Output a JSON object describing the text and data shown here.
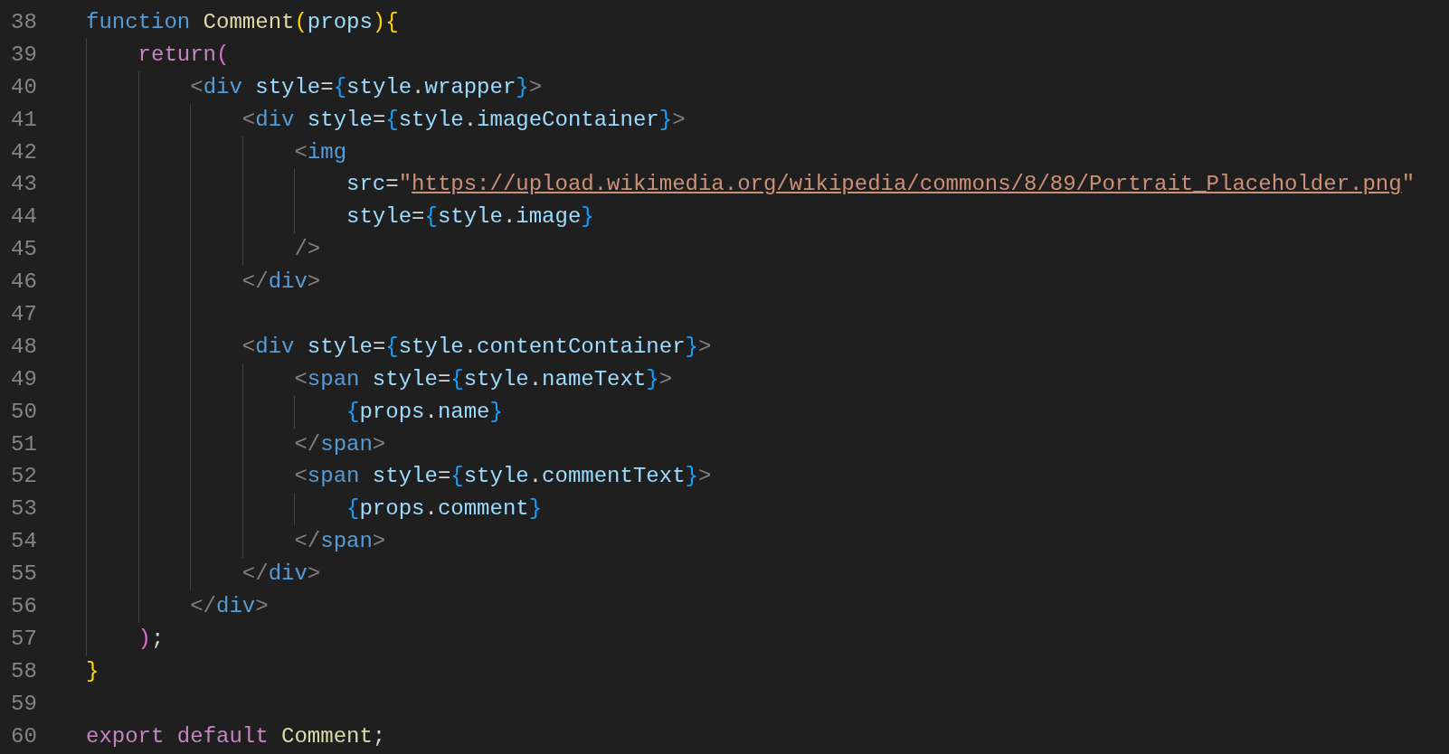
{
  "editor": {
    "lines": [
      {
        "number": "38",
        "tokens": [
          {
            "text": "function",
            "kind": "keyword"
          },
          {
            "text": " Comment",
            "kind": "function"
          },
          {
            "text": "(",
            "kind": "bracket1"
          },
          {
            "text": "props",
            "kind": "variable"
          },
          {
            "text": ")",
            "kind": "bracket1"
          },
          {
            "text": "{",
            "kind": "bracket1"
          }
        ]
      },
      {
        "number": "39",
        "tokens": [
          {
            "text": "    return",
            "kind": "control"
          },
          {
            "text": "(",
            "kind": "bracket2"
          }
        ]
      },
      {
        "number": "40",
        "tokens": [
          {
            "text": "        <",
            "kind": "tagpunct"
          },
          {
            "text": "div",
            "kind": "tag"
          },
          {
            "text": " style",
            "kind": "variable"
          },
          {
            "text": "=",
            "kind": "punct"
          },
          {
            "text": "{",
            "kind": "bracket3"
          },
          {
            "text": "style",
            "kind": "variable"
          },
          {
            "text": ".",
            "kind": "punct"
          },
          {
            "text": "wrapper",
            "kind": "variable"
          },
          {
            "text": "}",
            "kind": "bracket3"
          },
          {
            "text": ">",
            "kind": "tagpunct"
          }
        ]
      },
      {
        "number": "41",
        "tokens": [
          {
            "text": "            <",
            "kind": "tagpunct"
          },
          {
            "text": "div",
            "kind": "tag"
          },
          {
            "text": " style",
            "kind": "variable"
          },
          {
            "text": "=",
            "kind": "punct"
          },
          {
            "text": "{",
            "kind": "bracket3"
          },
          {
            "text": "style",
            "kind": "variable"
          },
          {
            "text": ".",
            "kind": "punct"
          },
          {
            "text": "imageContainer",
            "kind": "variable"
          },
          {
            "text": "}",
            "kind": "bracket3"
          },
          {
            "text": ">",
            "kind": "tagpunct"
          }
        ]
      },
      {
        "number": "42",
        "tokens": [
          {
            "text": "                <",
            "kind": "tagpunct"
          },
          {
            "text": "img",
            "kind": "tag"
          }
        ]
      },
      {
        "number": "43",
        "tokens": [
          {
            "text": "                    src",
            "kind": "variable"
          },
          {
            "text": "=",
            "kind": "punct"
          },
          {
            "text": "\"",
            "kind": "string"
          },
          {
            "text": "https://upload.wikimedia.org/wikipedia/commons/8/89/Portrait_Placeholder.png",
            "kind": "link"
          },
          {
            "text": "\"",
            "kind": "string"
          }
        ]
      },
      {
        "number": "44",
        "tokens": [
          {
            "text": "                    style",
            "kind": "variable"
          },
          {
            "text": "=",
            "kind": "punct"
          },
          {
            "text": "{",
            "kind": "bracket3"
          },
          {
            "text": "style",
            "kind": "variable"
          },
          {
            "text": ".",
            "kind": "punct"
          },
          {
            "text": "image",
            "kind": "variable"
          },
          {
            "text": "}",
            "kind": "bracket3"
          }
        ]
      },
      {
        "number": "45",
        "tokens": [
          {
            "text": "                />",
            "kind": "tagpunct"
          }
        ]
      },
      {
        "number": "46",
        "tokens": [
          {
            "text": "            </",
            "kind": "tagpunct"
          },
          {
            "text": "div",
            "kind": "tag"
          },
          {
            "text": ">",
            "kind": "tagpunct"
          }
        ]
      },
      {
        "number": "47"
      },
      {
        "number": "48",
        "tokens": [
          {
            "text": "            <",
            "kind": "tagpunct"
          },
          {
            "text": "div",
            "kind": "tag"
          },
          {
            "text": " style",
            "kind": "variable"
          },
          {
            "text": "=",
            "kind": "punct"
          },
          {
            "text": "{",
            "kind": "bracket3"
          },
          {
            "text": "style",
            "kind": "variable"
          },
          {
            "text": ".",
            "kind": "punct"
          },
          {
            "text": "contentContainer",
            "kind": "variable"
          },
          {
            "text": "}",
            "kind": "bracket3"
          },
          {
            "text": ">",
            "kind": "tagpunct"
          }
        ]
      },
      {
        "number": "49",
        "tokens": [
          {
            "text": "                <",
            "kind": "tagpunct"
          },
          {
            "text": "span",
            "kind": "tag"
          },
          {
            "text": " style",
            "kind": "variable"
          },
          {
            "text": "=",
            "kind": "punct"
          },
          {
            "text": "{",
            "kind": "bracket3"
          },
          {
            "text": "style",
            "kind": "variable"
          },
          {
            "text": ".",
            "kind": "punct"
          },
          {
            "text": "nameText",
            "kind": "variable"
          },
          {
            "text": "}",
            "kind": "bracket3"
          },
          {
            "text": ">",
            "kind": "tagpunct"
          }
        ]
      },
      {
        "number": "50",
        "tokens": [
          {
            "text": "                    {",
            "kind": "bracket3"
          },
          {
            "text": "props",
            "kind": "variable"
          },
          {
            "text": ".",
            "kind": "punct"
          },
          {
            "text": "name",
            "kind": "variable"
          },
          {
            "text": "}",
            "kind": "bracket3"
          }
        ]
      },
      {
        "number": "51",
        "tokens": [
          {
            "text": "                </",
            "kind": "tagpunct"
          },
          {
            "text": "span",
            "kind": "tag"
          },
          {
            "text": ">",
            "kind": "tagpunct"
          }
        ]
      },
      {
        "number": "52",
        "tokens": [
          {
            "text": "                <",
            "kind": "tagpunct"
          },
          {
            "text": "span",
            "kind": "tag"
          },
          {
            "text": " style",
            "kind": "variable"
          },
          {
            "text": "=",
            "kind": "punct"
          },
          {
            "text": "{",
            "kind": "bracket3"
          },
          {
            "text": "style",
            "kind": "variable"
          },
          {
            "text": ".",
            "kind": "punct"
          },
          {
            "text": "commentText",
            "kind": "variable"
          },
          {
            "text": "}",
            "kind": "bracket3"
          },
          {
            "text": ">",
            "kind": "tagpunct"
          }
        ]
      },
      {
        "number": "53",
        "tokens": [
          {
            "text": "                    {",
            "kind": "bracket3"
          },
          {
            "text": "props",
            "kind": "variable"
          },
          {
            "text": ".",
            "kind": "punct"
          },
          {
            "text": "comment",
            "kind": "variable"
          },
          {
            "text": "}",
            "kind": "bracket3"
          }
        ]
      },
      {
        "number": "54",
        "tokens": [
          {
            "text": "                </",
            "kind": "tagpunct"
          },
          {
            "text": "span",
            "kind": "tag"
          },
          {
            "text": ">",
            "kind": "tagpunct"
          }
        ]
      },
      {
        "number": "55",
        "tokens": [
          {
            "text": "            </",
            "kind": "tagpunct"
          },
          {
            "text": "div",
            "kind": "tag"
          },
          {
            "text": ">",
            "kind": "tagpunct"
          }
        ]
      },
      {
        "number": "56",
        "tokens": [
          {
            "text": "        </",
            "kind": "tagpunct"
          },
          {
            "text": "div",
            "kind": "tag"
          },
          {
            "text": ">",
            "kind": "tagpunct"
          }
        ]
      },
      {
        "number": "57",
        "tokens": [
          {
            "text": "    )",
            "kind": "bracket2"
          },
          {
            "text": ";",
            "kind": "punct"
          }
        ]
      },
      {
        "number": "58",
        "tokens": [
          {
            "text": "}",
            "kind": "bracket1"
          }
        ]
      },
      {
        "number": "59"
      },
      {
        "number": "60",
        "tokens": [
          {
            "text": "export",
            "kind": "control"
          },
          {
            "text": " default",
            "kind": "control"
          },
          {
            "text": " Comment",
            "kind": "function"
          },
          {
            "text": ";",
            "kind": "punct"
          }
        ]
      }
    ]
  }
}
